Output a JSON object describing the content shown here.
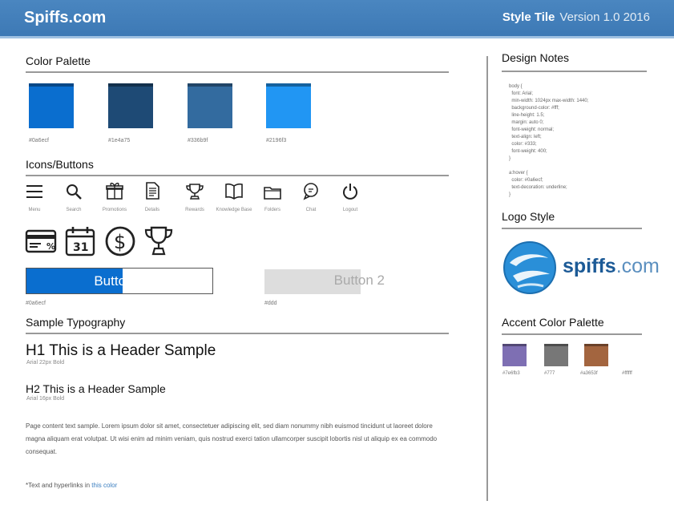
{
  "header": {
    "brand": "Spiffs.com",
    "tile_label": "Style Tile",
    "tile_sub": "Version 1.0 2016"
  },
  "sections": {
    "color_palette": "Color Palette",
    "icons_buttons": "Icons/Buttons",
    "sample_typography": "Sample Typography",
    "design_notes": "Design Notes",
    "logo_style": "Logo Style",
    "accent_palette": "Accent Color Palette"
  },
  "palette": [
    {
      "color": "#0a6ecf",
      "label": "#0a6ecf"
    },
    {
      "color": "#1e4a75",
      "label": "#1e4a75"
    },
    {
      "color": "#336b9f",
      "label": "#336b9f"
    },
    {
      "color": "#2196f3",
      "label": "#2196f3"
    }
  ],
  "icons": [
    {
      "name": "menu-icon",
      "label": "Menu"
    },
    {
      "name": "search-icon",
      "label": "Search"
    },
    {
      "name": "gift-icon",
      "label": "Promotions"
    },
    {
      "name": "document-icon",
      "label": "Details"
    },
    {
      "name": "trophy-icon",
      "label": "Rewards"
    },
    {
      "name": "book-icon",
      "label": "Knowledge Base"
    },
    {
      "name": "folder-icon",
      "label": "Folders"
    },
    {
      "name": "chat-icon",
      "label": "Chat"
    },
    {
      "name": "power-icon",
      "label": "Logout"
    }
  ],
  "buttons": {
    "button1": "Button 1",
    "button2": "Button 2",
    "button1_note": "#0a6ecf",
    "button2_note": "#ddd"
  },
  "typography": {
    "h1": "H1 This is a Header Sample",
    "h1_font": "Arial 22px Bold",
    "h2": "H2 This is a Header Sample",
    "h2_font": "Arial 16px Bold",
    "body": "Page content text sample. Lorem ipsum dolor sit amet, consectetuer adipiscing elit, sed diam nonummy nibh euismod tincidunt ut laoreet dolore magna aliquam erat volutpat. Ut wisi enim ad minim veniam, quis nostrud exerci tation ullamcorper suscipit lobortis nisl ut aliquip ex ea commodo consequat.",
    "footnote_prefix": "*Text and hyperlinks in ",
    "footnote_link": "this color"
  },
  "design_notes": "body {\n  font: Arial;\n  min-width: 1024px max-width: 1440;\n  background-color: #fff;\n  line-height: 1.5;\n  margin: auto 0;\n  font-weight: normal;\n  text-align: left;\n  color: #333;\n  font-weight: 400;\n}\n\na:hover {\n  color: #0a6ecf;\n  text-decoration: underline;\n}",
  "logo": {
    "text_a": "spiffs",
    "text_b": ".com"
  },
  "accents": [
    {
      "color": "#7e6fb3",
      "label": "#7e6fb3"
    },
    {
      "color": "#777",
      "label": "#777"
    },
    {
      "color": "#a3653f",
      "label": "#a3653f"
    },
    {
      "color": "#fff",
      "label": "#ffffff"
    }
  ]
}
